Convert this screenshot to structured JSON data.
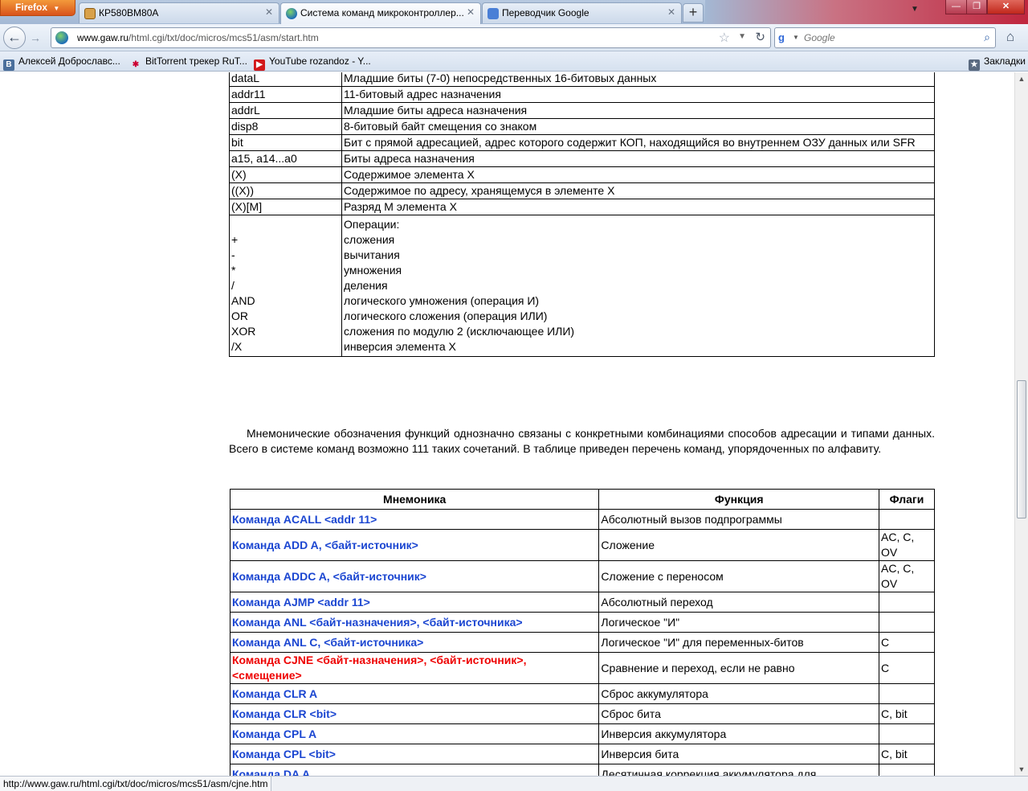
{
  "browser": {
    "menu_button": "Firefox",
    "tabs": [
      {
        "title": "КР580ВМ80А"
      },
      {
        "title": "Система команд микроконтроллер..."
      },
      {
        "title": "Переводчик Google"
      }
    ],
    "new_tab_label": "+",
    "url_host": "www.gaw.ru",
    "url_path": "/html.cgi/txt/doc/micros/mcs51/asm/start.htm",
    "search_placeholder": "Google",
    "bookmarks": [
      {
        "label": "Алексей Доброславс..."
      },
      {
        "label": "BitTorrent трекер RuT..."
      },
      {
        "label": "YouTube rozandoz - Y..."
      }
    ],
    "bookmarks_menu": "Закладки",
    "status_url": "http://www.gaw.ru/html.cgi/txt/doc/micros/mcs51/asm/cjne.htm"
  },
  "symbols": [
    {
      "symbol": "dataL",
      "meaning": "Младшие биты (7-0) непосредственных 16-битовых данных"
    },
    {
      "symbol": "addr11",
      "meaning": "11-битовый адрес назначения"
    },
    {
      "symbol": "addrL",
      "meaning": "Младшие биты адреса назначения"
    },
    {
      "symbol": "disp8",
      "meaning": "8-битовый байт смещения со знаком"
    },
    {
      "symbol": "bit",
      "meaning": "Бит с прямой адресацией, адрес которого содержит КОП, находящийся во внутреннем ОЗУ данных или SFR"
    },
    {
      "symbol": "a15, a14...a0",
      "meaning": "Биты адреса назначения"
    },
    {
      "symbol": "(X)",
      "meaning": "Содержимое элемента Х"
    },
    {
      "symbol": "((X))",
      "meaning": "Содержимое по адресу, хранящемуся в элементе Х"
    },
    {
      "symbol": "(X)[M]",
      "meaning": "Разряд М элемента Х"
    }
  ],
  "operations": {
    "heading": "Операции:",
    "items": [
      {
        "symbol": "+",
        "meaning": "сложения"
      },
      {
        "symbol": "-",
        "meaning": "вычитания"
      },
      {
        "symbol": "*",
        "meaning": "умножения"
      },
      {
        "symbol": "/",
        "meaning": "деления"
      },
      {
        "symbol": "AND",
        "meaning": "логического умножения (операция И)"
      },
      {
        "symbol": "OR",
        "meaning": "логического сложения (операция ИЛИ)"
      },
      {
        "symbol": "XOR",
        "meaning": "сложения по модулю 2 (исключающее ИЛИ)"
      },
      {
        "symbol": "/X",
        "meaning": "инверсия элемента Х"
      }
    ]
  },
  "paragraph": "Мнемонические обозначения функций однозначно связаны с конкретными комбинациями способов адресации и типами данных. Всего в системе команд возможно 111 таких сочетаний. В таблице приведен перечень команд, упорядоченных по алфавиту.",
  "commands_table": {
    "headers": {
      "mnemonic": "Мнемоника",
      "function": "Функция",
      "flags": "Флаги"
    },
    "rows": [
      {
        "mnemonic": "Команда ACALL <addr 11>",
        "function": "Абсолютный вызов подпрограммы",
        "flags": ""
      },
      {
        "mnemonic": "Команда ADD A, <байт-источник>",
        "function": "Сложение",
        "flags": "AC, C, OV"
      },
      {
        "mnemonic": "Команда ADDC A, <байт-источник>",
        "function": "Сложение с переносом",
        "flags": "AC, C, OV"
      },
      {
        "mnemonic": "Команда AJMP <addr 11>",
        "function": "Абсолютный переход",
        "flags": ""
      },
      {
        "mnemonic": "Команда ANL <байт-назначения>, <байт-источника>",
        "function": "Логическое \"И\"",
        "flags": ""
      },
      {
        "mnemonic": "Команда ANL C, <байт-источника>",
        "function": "Логическое \"И\" для переменных-битов",
        "flags": "C"
      },
      {
        "mnemonic": "Команда CJNE <байт-назначения>, <байт-источник>, <смещение>",
        "function": "Сравнение и переход, если не равно",
        "flags": "C",
        "visited": true
      },
      {
        "mnemonic": "Команда CLR A",
        "function": "Сброс аккумулятора",
        "flags": ""
      },
      {
        "mnemonic": "Команда CLR <bit>",
        "function": "Сброс бита",
        "flags": "C, bit"
      },
      {
        "mnemonic": "Команда CPL A",
        "function": "Инверсия аккумулятора",
        "flags": ""
      },
      {
        "mnemonic": "Команда CPL <bit>",
        "function": "Инверсия бита",
        "flags": "C, bit"
      },
      {
        "mnemonic": "Команда DA A",
        "function": "Десятичная коррекция аккумулятора для",
        "flags": ""
      }
    ]
  }
}
